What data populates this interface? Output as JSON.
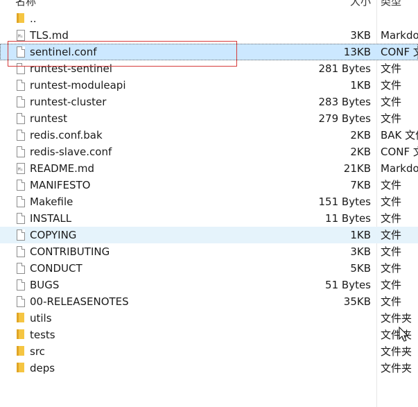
{
  "header": {
    "name_label": "名称",
    "size_label": "大小",
    "type_label": "类型"
  },
  "files": [
    {
      "name": "..",
      "size": "",
      "type": "",
      "icon": "folder-icon",
      "state": ""
    },
    {
      "name": "TLS.md",
      "size": "3KB",
      "type": "Markdown",
      "icon": "markdown-file-icon",
      "state": ""
    },
    {
      "name": "sentinel.conf",
      "size": "13KB",
      "type": "CONF 文件",
      "icon": "file-icon",
      "state": "selected"
    },
    {
      "name": "runtest-sentinel",
      "size": "281 Bytes",
      "type": "文件",
      "icon": "file-icon",
      "state": ""
    },
    {
      "name": "runtest-moduleapi",
      "size": "1KB",
      "type": "文件",
      "icon": "file-icon",
      "state": ""
    },
    {
      "name": "runtest-cluster",
      "size": "283 Bytes",
      "type": "文件",
      "icon": "file-icon",
      "state": ""
    },
    {
      "name": "runtest",
      "size": "279 Bytes",
      "type": "文件",
      "icon": "file-icon",
      "state": ""
    },
    {
      "name": "redis.conf.bak",
      "size": "2KB",
      "type": "BAK 文件",
      "icon": "file-icon",
      "state": ""
    },
    {
      "name": "redis-slave.conf",
      "size": "2KB",
      "type": "CONF 文件",
      "icon": "file-icon",
      "state": ""
    },
    {
      "name": "README.md",
      "size": "21KB",
      "type": "Markdown",
      "icon": "markdown-file-icon",
      "state": ""
    },
    {
      "name": "MANIFESTO",
      "size": "7KB",
      "type": "文件",
      "icon": "file-icon",
      "state": ""
    },
    {
      "name": "Makefile",
      "size": "151 Bytes",
      "type": "文件",
      "icon": "file-icon",
      "state": ""
    },
    {
      "name": "INSTALL",
      "size": "11 Bytes",
      "type": "文件",
      "icon": "file-icon",
      "state": ""
    },
    {
      "name": "COPYING",
      "size": "1KB",
      "type": "文件",
      "icon": "file-icon",
      "state": "hover"
    },
    {
      "name": "CONTRIBUTING",
      "size": "3KB",
      "type": "文件",
      "icon": "file-icon",
      "state": ""
    },
    {
      "name": "CONDUCT",
      "size": "5KB",
      "type": "文件",
      "icon": "file-icon",
      "state": ""
    },
    {
      "name": "BUGS",
      "size": "51 Bytes",
      "type": "文件",
      "icon": "file-icon",
      "state": ""
    },
    {
      "name": "00-RELEASENOTES",
      "size": "35KB",
      "type": "文件",
      "icon": "file-icon",
      "state": ""
    },
    {
      "name": "utils",
      "size": "",
      "type": "文件夹",
      "icon": "folder-icon",
      "state": ""
    },
    {
      "name": "tests",
      "size": "",
      "type": "文件夹",
      "icon": "folder-icon",
      "state": ""
    },
    {
      "name": "src",
      "size": "",
      "type": "文件夹",
      "icon": "folder-icon",
      "state": ""
    },
    {
      "name": "deps",
      "size": "",
      "type": "文件夹",
      "icon": "folder-icon",
      "state": ""
    }
  ],
  "colors": {
    "selected_bg": "#cce8ff",
    "hover_bg": "#e5f3fb",
    "annotation": "#d63b3b",
    "folder": "#f5c542"
  }
}
